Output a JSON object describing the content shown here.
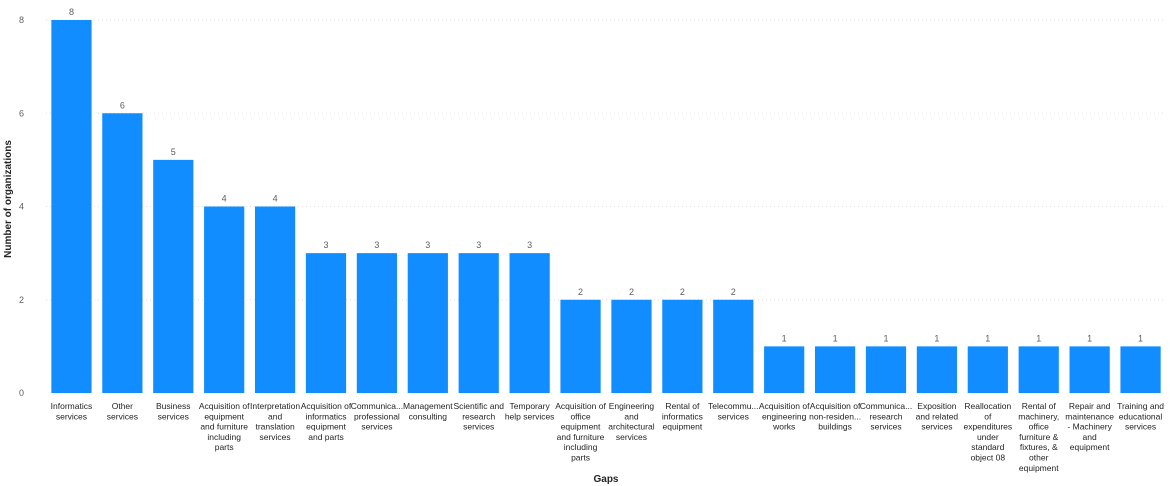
{
  "chart_data": {
    "type": "bar",
    "xlabel": "Gaps",
    "ylabel": "Number of organizations",
    "ylim": [
      0,
      8
    ],
    "yticks": [
      0,
      2,
      4,
      6,
      8
    ],
    "grid": true,
    "bar_color": "#118DFF",
    "categories": [
      "Informatics services",
      "Other services",
      "Business services",
      "Acquisition of equipment and furniture including parts",
      "Interpretation and translation services",
      "Acquisition of informatics equipment and parts",
      "Communica... professional services",
      "Management consulting",
      "Scientific and research services",
      "Temporary help services",
      "Acquisition of office equipment and furniture including parts",
      "Engineering and architectural services",
      "Rental of informatics equipment",
      "Telecommu... services",
      "Acquisition of engineering works",
      "Acquisition of non-residen... buildings",
      "Communica... research services",
      "Exposition and related services",
      "Reallocation of expenditures under standard object 08",
      "Rental of machinery, office furniture & fixtures, & other equipment",
      "Repair and maintenance - Machinery and equipment",
      "Training and educational services"
    ],
    "category_lines": [
      [
        "Informatics",
        "services"
      ],
      [
        "Other",
        "services"
      ],
      [
        "Business",
        "services"
      ],
      [
        "Acquisition of",
        "equipment",
        "and furniture",
        "including",
        "parts"
      ],
      [
        "Interpretation",
        "and",
        "translation",
        "services"
      ],
      [
        "Acquisition of",
        "informatics",
        "equipment",
        "and parts"
      ],
      [
        "Communica...",
        "professional",
        "services"
      ],
      [
        "Management",
        "consulting"
      ],
      [
        "Scientific and",
        "research",
        "services"
      ],
      [
        "Temporary",
        "help services"
      ],
      [
        "Acquisition of",
        "office",
        "equipment",
        "and furniture",
        "including",
        "parts"
      ],
      [
        "Engineering",
        "and",
        "architectural",
        "services"
      ],
      [
        "Rental of",
        "informatics",
        "equipment"
      ],
      [
        "Telecommu...",
        "services"
      ],
      [
        "Acquisition of",
        "engineering",
        "works"
      ],
      [
        "Acquisition of",
        "non-residen...",
        "buildings"
      ],
      [
        "Communica...",
        "research",
        "services"
      ],
      [
        "Exposition",
        "and related",
        "services"
      ],
      [
        "Reallocation",
        "of",
        "expenditures",
        "under",
        "standard",
        "object 08"
      ],
      [
        "Rental of",
        "machinery,",
        "office",
        "furniture &",
        "fixtures, &",
        "other",
        "equipment"
      ],
      [
        "Repair and",
        "maintenance",
        "- Machinery",
        "and",
        "equipment"
      ],
      [
        "Training and",
        "educational",
        "services"
      ]
    ],
    "values": [
      8,
      6,
      5,
      4,
      4,
      3,
      3,
      3,
      3,
      3,
      2,
      2,
      2,
      2,
      1,
      1,
      1,
      1,
      1,
      1,
      1,
      1
    ]
  }
}
